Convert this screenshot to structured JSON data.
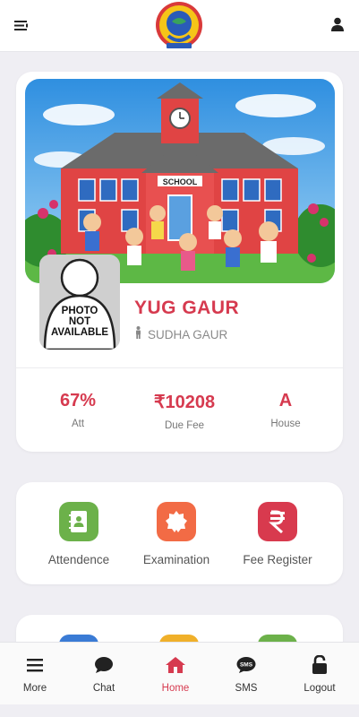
{
  "header": {
    "menu_icon": "menu-icon",
    "profile_icon": "user-icon",
    "logo_icon": "school-logo"
  },
  "profile": {
    "photo_placeholder": "PHOTO NOT AVAILABLE",
    "photo_lines": [
      "PHOTO",
      "NOT",
      "AVAILABLE"
    ],
    "banner_sign": "SCHOOL",
    "student_name": "YUG GAUR",
    "parent_name": "SUDHA GAUR",
    "parent_icon": "person-icon",
    "stats": [
      {
        "value": "67%",
        "label": "Att"
      },
      {
        "value": "₹10208",
        "label": "Due Fee"
      },
      {
        "value": "A",
        "label": "House"
      }
    ]
  },
  "actions": [
    {
      "label": "Attendence",
      "icon": "contact-book-icon",
      "color": "#6cb14a"
    },
    {
      "label": "Examination",
      "icon": "badge-icon",
      "color": "#f26b45"
    },
    {
      "label": "Fee Register",
      "icon": "rupee-icon",
      "color": "#d83a4e"
    }
  ],
  "nav": [
    {
      "label": "More",
      "icon": "menu-icon"
    },
    {
      "label": "Chat",
      "icon": "chat-bubble-icon"
    },
    {
      "label": "Home",
      "icon": "home-icon",
      "active": true
    },
    {
      "label": "SMS",
      "icon": "sms-bubble-icon"
    },
    {
      "label": "Logout",
      "icon": "unlock-icon"
    }
  ],
  "colors": {
    "accent": "#d63a4f",
    "background": "#efeef3"
  }
}
